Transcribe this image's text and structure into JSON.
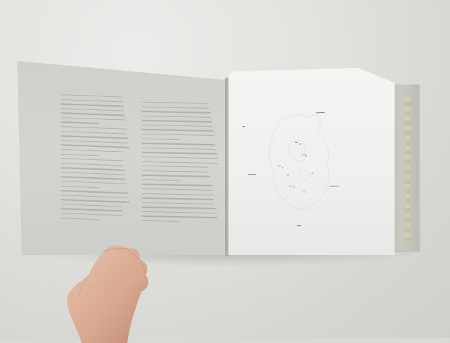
{
  "scene": {
    "description_type": "photograph",
    "colors": {
      "background": "#d9dad6",
      "left_page": "#d2d2ce",
      "right_page": "#f2f2f0",
      "back_cover": "#c4c3bc",
      "skin": "#e0b6a0",
      "ink": "#9e9e99"
    }
  },
  "book": {
    "left_page": {
      "paragraph_count": 2
    },
    "right_page": {
      "map_labels": []
    }
  }
}
